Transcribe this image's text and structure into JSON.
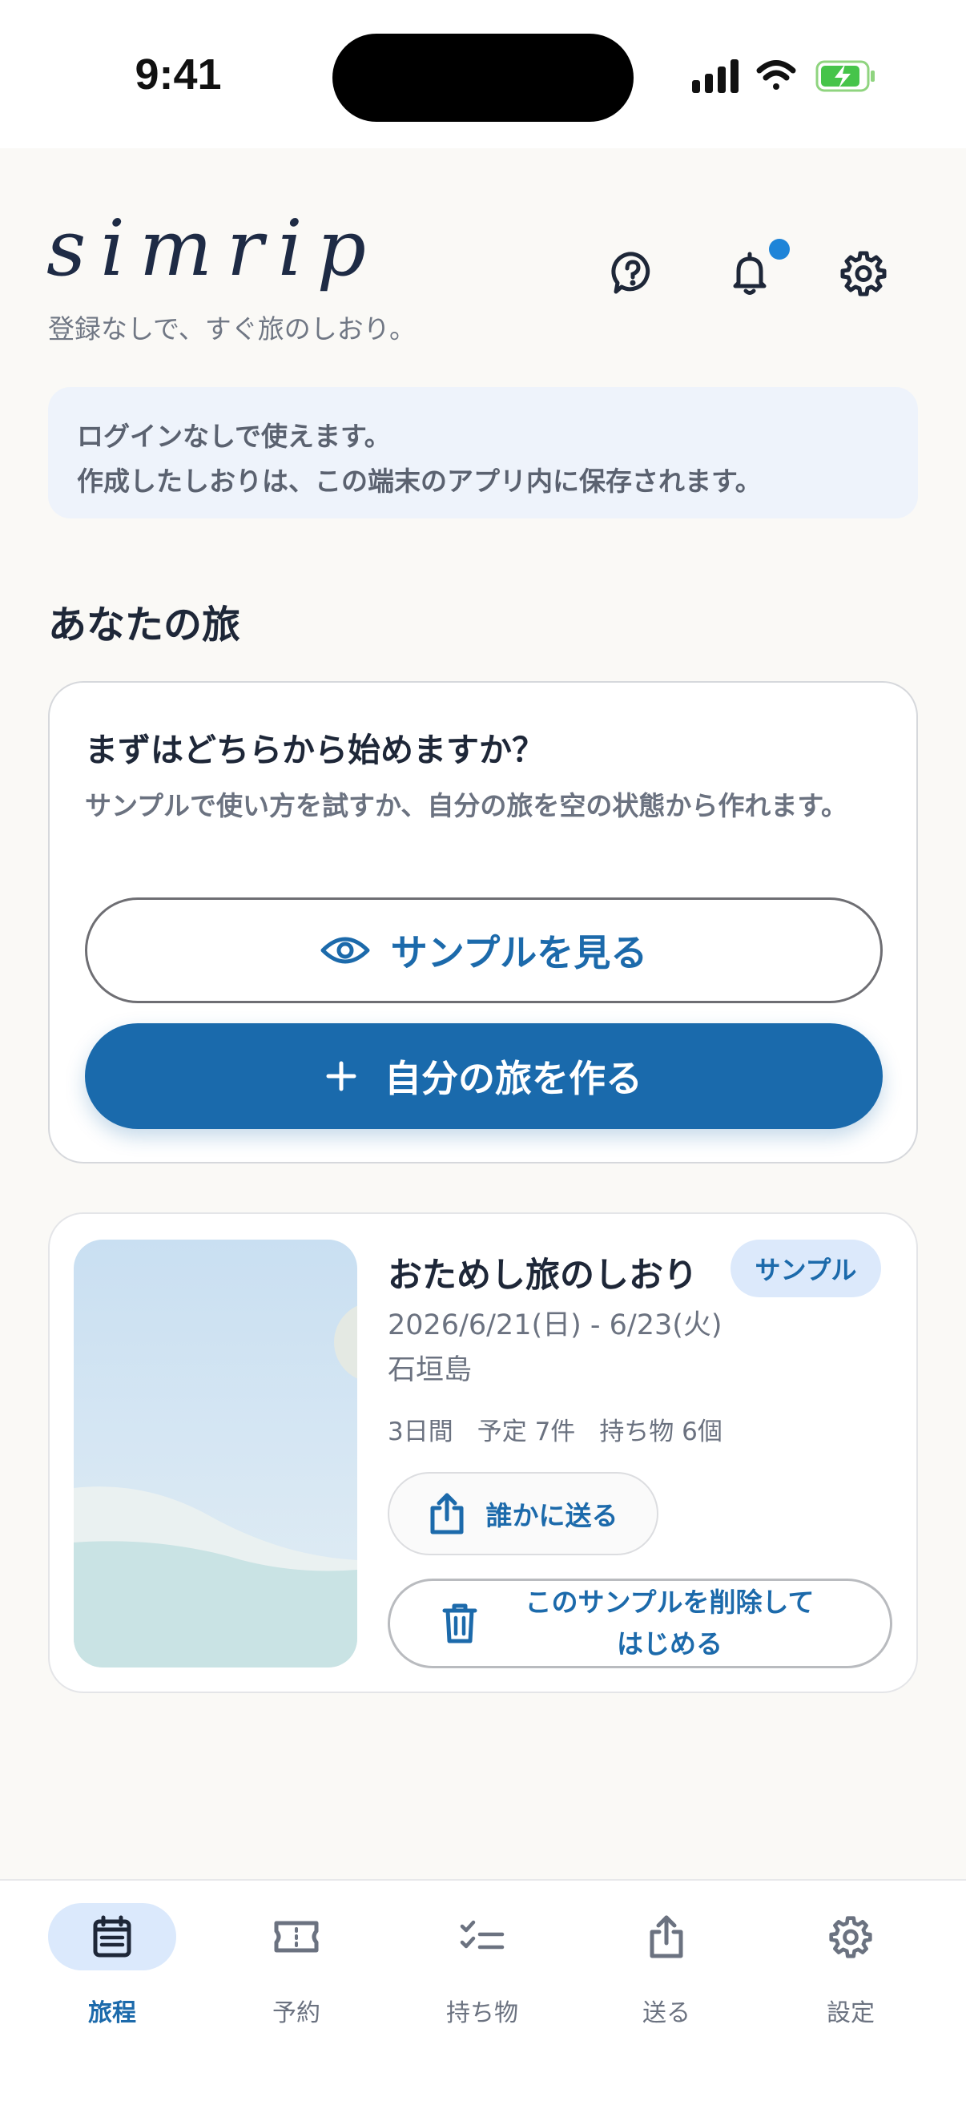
{
  "status_bar": {
    "time": "9:41"
  },
  "header": {
    "logo": "simrip",
    "tagline": "登録なしで、すぐ旅のしおり。",
    "icons": [
      "help-icon",
      "bell-icon",
      "gear-icon"
    ],
    "has_notification": true
  },
  "info_banner": {
    "line1": "ログインなしで使えます。",
    "line2": "作成したしおりは、この端末のアプリ内に保存されます。"
  },
  "section_title": "あなたの旅",
  "start_card": {
    "title": "まずはどちらから始めますか？",
    "description": "サンプルで使い方を試すか、自分の旅を空の状態から作れます。",
    "sample_button": "サンプルを見る",
    "create_button": "自分の旅を作る"
  },
  "trip_card": {
    "title": "おためし旅のしおり",
    "badge": "サンプル",
    "dates": "2026/6/21(日) - 6/23(火)",
    "place": "石垣島",
    "stats": {
      "days": "3日間",
      "plans": "予定 7件",
      "items": "持ち物 6個"
    },
    "share_button": "誰かに送る",
    "delete_button_line1": "このサンプルを削除して",
    "delete_button_line2": "はじめる"
  },
  "bottom_nav": {
    "items": [
      {
        "label": "旅程",
        "icon": "calendar-icon",
        "active": true
      },
      {
        "label": "予約",
        "icon": "ticket-icon",
        "active": false
      },
      {
        "label": "持ち物",
        "icon": "checklist-icon",
        "active": false
      },
      {
        "label": "送る",
        "icon": "share-icon",
        "active": false
      },
      {
        "label": "設定",
        "icon": "gear-icon",
        "active": false
      }
    ]
  },
  "colors": {
    "accent": "#1a6aac",
    "badge_bg": "#dce9fb",
    "banner_bg": "#eef3fb",
    "notification_dot": "#1e84d8"
  }
}
